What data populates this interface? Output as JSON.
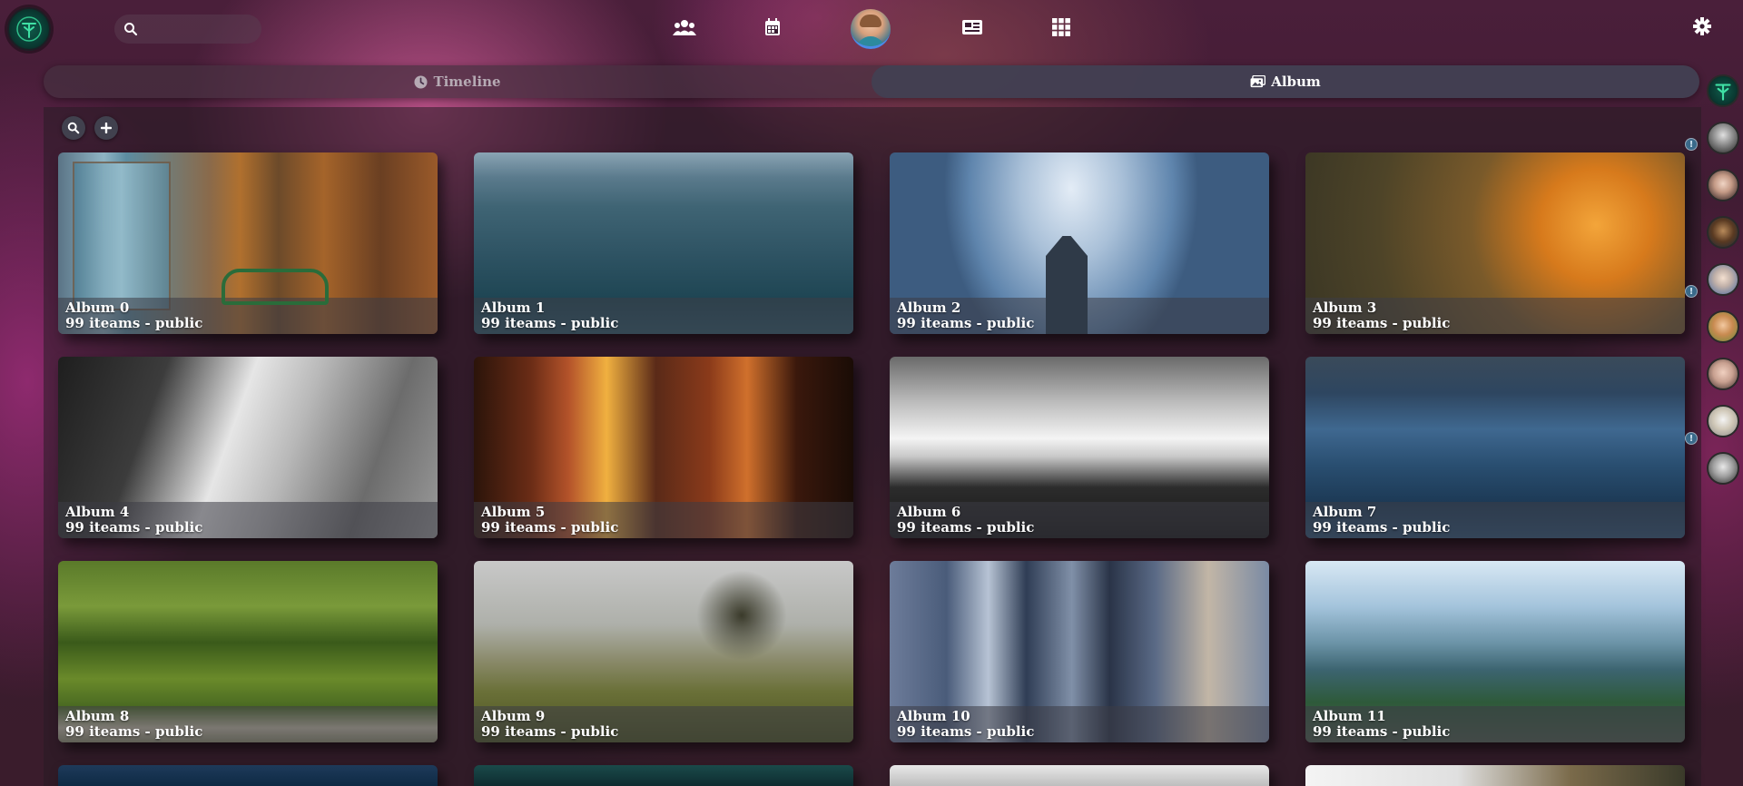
{
  "nav": {
    "search_placeholder": "",
    "icons": [
      "users-icon",
      "calendar-icon",
      "profile-avatar",
      "newspaper-icon",
      "grid-icon",
      "settings-icon"
    ]
  },
  "tabs": [
    {
      "label": "Timeline",
      "icon": "clock-icon",
      "active": false
    },
    {
      "label": "Album",
      "icon": "images-icon",
      "active": true
    }
  ],
  "toolbar": {
    "search_icon": "search-icon",
    "add_icon": "plus-icon"
  },
  "albums": [
    {
      "title": "Album 0",
      "subtitle": "99 iteams - public"
    },
    {
      "title": "Album 1",
      "subtitle": "99 iteams - public"
    },
    {
      "title": "Album 2",
      "subtitle": "99 iteams - public"
    },
    {
      "title": "Album 3",
      "subtitle": "99 iteams - public"
    },
    {
      "title": "Album 4",
      "subtitle": "99 iteams - public"
    },
    {
      "title": "Album 5",
      "subtitle": "99 iteams - public"
    },
    {
      "title": "Album 6",
      "subtitle": "99 iteams - public"
    },
    {
      "title": "Album 7",
      "subtitle": "99 iteams - public"
    },
    {
      "title": "Album 8",
      "subtitle": "99 iteams - public"
    },
    {
      "title": "Album 9",
      "subtitle": "99 iteams - public"
    },
    {
      "title": "Album 10",
      "subtitle": "99 iteams - public"
    },
    {
      "title": "Album 11",
      "subtitle": "99 iteams - public"
    }
  ],
  "sidebar": {
    "contacts": [
      "logo-avatar",
      "contact-1",
      "contact-2",
      "contact-3",
      "contact-4",
      "contact-5",
      "contact-6",
      "contact-7",
      "contact-8"
    ],
    "badge_text": "!"
  },
  "colors": {
    "accent": "#4b8be8",
    "tab_active": "#424052",
    "toolbar_button": "#41414e"
  }
}
